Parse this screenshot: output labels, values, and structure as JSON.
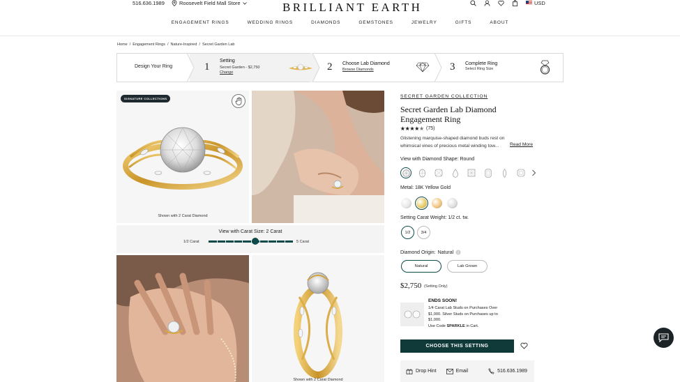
{
  "header": {
    "phone": "516.636.1989",
    "store": "Roosevelt Field Mall Store",
    "logo": "BRILLIANT EARTH",
    "currency": "USD"
  },
  "nav": [
    "ENGAGEMENT RINGS",
    "WEDDING RINGS",
    "DIAMONDS",
    "GEMSTONES",
    "JEWELRY",
    "GIFTS",
    "ABOUT"
  ],
  "breadcrumb": [
    "Home",
    "/",
    "Engagement Rings",
    "/",
    "Nature-Inspired",
    "/",
    "Secret Garden Lab"
  ],
  "steps": {
    "design": "Design Your Ring",
    "s1": {
      "num": "1",
      "title": "Setting",
      "sub": "Secret Garden - $2,750",
      "link": "Change"
    },
    "s2": {
      "num": "2",
      "title": "Choose Lab Diamond",
      "link": "Browse Diamonds"
    },
    "s3": {
      "num": "3",
      "title": "Complete Ring",
      "sub": "Select Ring Size"
    }
  },
  "gallery": {
    "badge": "SIGNATURE COLLECTIONS",
    "caption1": "Shown with 2 Carat Diamond",
    "carat_title": "View with Carat Size:",
    "carat_value": "2 Carat",
    "carat_min": "1/2 Carat",
    "carat_max": "5 Carat",
    "carat_level": 0.55,
    "caption4": "Shown with 2 Carat Diamond"
  },
  "product": {
    "collection": "SECRET GARDEN COLLECTION",
    "title": "Secret Garden Lab Diamond Engagement Ring",
    "rating": 4.5,
    "reviews": "(75)",
    "desc": "Glistening marquise-shaped diamond buds rest on whimsical vines of precious metal winding tow...",
    "read_more": "Read More",
    "shape_label": "View with Diamond Shape:",
    "shape_value": "Round",
    "metal_label": "Metal:",
    "metal_value": "18K Yellow Gold",
    "metal_colors": [
      "#e6e6e6",
      "#e8c95d",
      "#f0c27a",
      "#dcdcdc"
    ],
    "weight_label": "Setting Carat Weight:",
    "weight_value": "1/2 ct. tw.",
    "weights": [
      "1/2",
      "3/4"
    ],
    "origin_label": "Diamond Origin:",
    "origin_value": "Natural",
    "origins": [
      "Natural",
      "Lab Grown"
    ],
    "price": "$2,750",
    "price_note": "(Setting Only)",
    "ends": "ENDS SOON!",
    "promo": "1/4 Carat Lab Studs on Purchases Over $1,000. Silver Studs on Purchases up to $1,000.",
    "promo_code_pre": "Use Code",
    "promo_code": "SPARKLE",
    "promo_code_post": "in Cart.",
    "cta": "CHOOSE THIS SETTING",
    "drop_hint": "Drop Hint",
    "email": "Email",
    "phone": "516.636.1989"
  },
  "colors": {
    "accent": "#10393a",
    "gold": "#d9a93a"
  }
}
